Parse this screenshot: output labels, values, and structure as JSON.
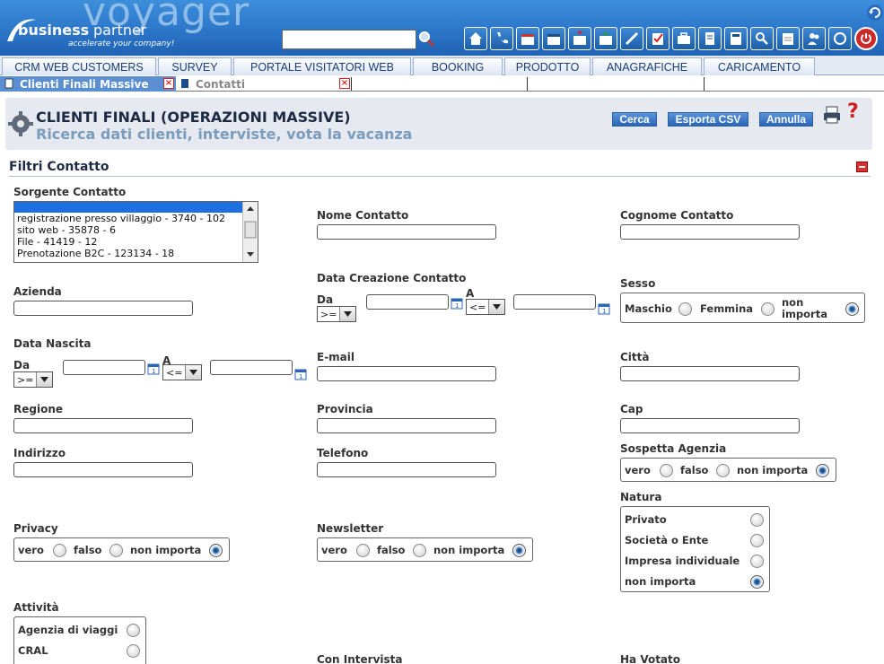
{
  "header": {
    "logo_big": "voyager",
    "logo_bp_bold": "business",
    "logo_bp_light": "partner",
    "logo_tagline": "accelerate your company!",
    "search_value": ""
  },
  "menu": [
    {
      "label": "CRM WEB CUSTOMERS"
    },
    {
      "label": "SURVEY"
    },
    {
      "label": "PORTALE VISITATORI WEB"
    },
    {
      "label": "BOOKING"
    },
    {
      "label": "PRODOTTO"
    },
    {
      "label": "ANAGRAFICHE"
    },
    {
      "label": "CARICAMENTO"
    }
  ],
  "subtabs": [
    {
      "label": "Clienti Finali Massive"
    },
    {
      "label": "Contatti"
    }
  ],
  "page": {
    "title": "CLIENTI FINALI (OPERAZIONI MASSIVE)",
    "subtitle": "Ricerca dati clienti, interviste, vota la vacanza",
    "btn_cerca": "Cerca",
    "btn_csv": "Esporta CSV",
    "btn_annulla": "Annulla",
    "help": "?"
  },
  "filters": {
    "section": "Filtri Contatto",
    "sorgente_label": "Sorgente Contatto",
    "sorgente_items": [
      "registrazione presso villaggio - 3740 - 102",
      "sito web - 35878 - 6",
      "File - 41419 - 12",
      "Prenotazione B2C - 123134 - 18"
    ],
    "nome_label": "Nome Contatto",
    "cognome_label": "Cognome Contatto",
    "azienda_label": "Azienda",
    "data_creazione_label": "Data Creazione Contatto",
    "da": "Da",
    "a": "A",
    "op_ge": ">=",
    "op_le": "<=",
    "cal_day": "1",
    "sesso_label": "Sesso",
    "sesso_opts": [
      "Maschio",
      "Femmina",
      "non importa"
    ],
    "data_nascita_label": "Data Nascita",
    "email_label": "E-mail",
    "citta_label": "Città",
    "regione_label": "Regione",
    "provincia_label": "Provincia",
    "cap_label": "Cap",
    "indirizzo_label": "Indirizzo",
    "telefono_label": "Telefono",
    "sospetta_label": "Sospetta Agenzia",
    "bool_opts": [
      "vero",
      "falso",
      "non importa"
    ],
    "natura_label": "Natura",
    "natura_opts": [
      "Privato",
      "Società o Ente",
      "Impresa individuale",
      "non importa"
    ],
    "privacy_label": "Privacy",
    "newsletter_label": "Newsletter",
    "attivita_label": "Attività",
    "attivita_opts": [
      "Agenzia di viaggi",
      "CRAL"
    ],
    "con_intervista_label": "Con Intervista",
    "ha_votato_label": "Ha Votato"
  }
}
